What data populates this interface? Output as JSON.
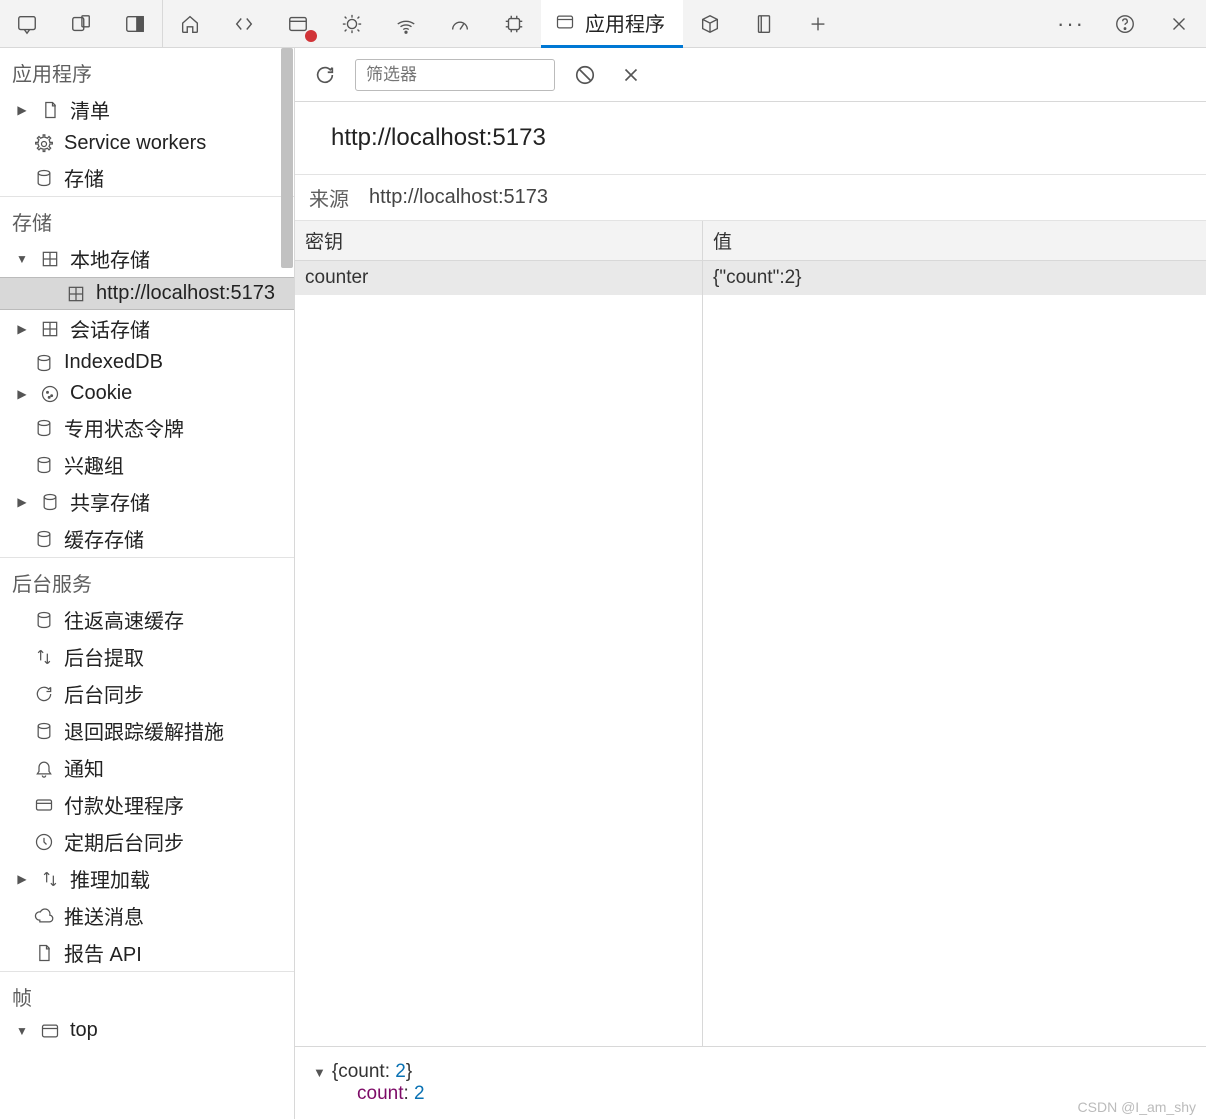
{
  "topbar": {
    "active_tab_label": "应用程序"
  },
  "sidebar": {
    "section_app": "应用程序",
    "app_items": {
      "manifest": "清单",
      "service_workers": "Service workers",
      "storage": "存储"
    },
    "section_storage": "存储",
    "storage_items": {
      "local_storage": "本地存储",
      "local_storage_child": "http://localhost:5173",
      "session_storage": "会话存储",
      "indexeddb": "IndexedDB",
      "cookie": "Cookie",
      "private_state_tokens": "专用状态令牌",
      "interest_groups": "兴趣组",
      "shared_storage": "共享存储",
      "cache_storage": "缓存存储"
    },
    "section_bgsvc": "后台服务",
    "bgsvc_items": {
      "bf_cache": "往返高速缓存",
      "bg_fetch": "后台提取",
      "bg_sync": "后台同步",
      "bounce_tracking": "退回跟踪缓解措施",
      "notifications": "通知",
      "payment_handler": "付款处理程序",
      "periodic_sync": "定期后台同步",
      "speculative_loads": "推理加载",
      "push_messaging": "推送消息",
      "reporting_api": "报告 API"
    },
    "section_frames": "帧",
    "frames_items": {
      "top": "top"
    }
  },
  "toolbar": {
    "filter_placeholder": "筛选器"
  },
  "origin": {
    "title": "http://localhost:5173",
    "label": "来源",
    "value": "http://localhost:5173"
  },
  "table": {
    "col_key": "密钥",
    "col_val": "值",
    "rows": [
      {
        "key": "counter",
        "val": "{\"count\":2}"
      }
    ]
  },
  "object_viewer": {
    "summary_open": "{count: ",
    "summary_val": "2",
    "summary_close": "}",
    "prop_name": "count",
    "prop_sep": ": ",
    "prop_val": "2"
  },
  "watermark": "CSDN @I_am_shy"
}
